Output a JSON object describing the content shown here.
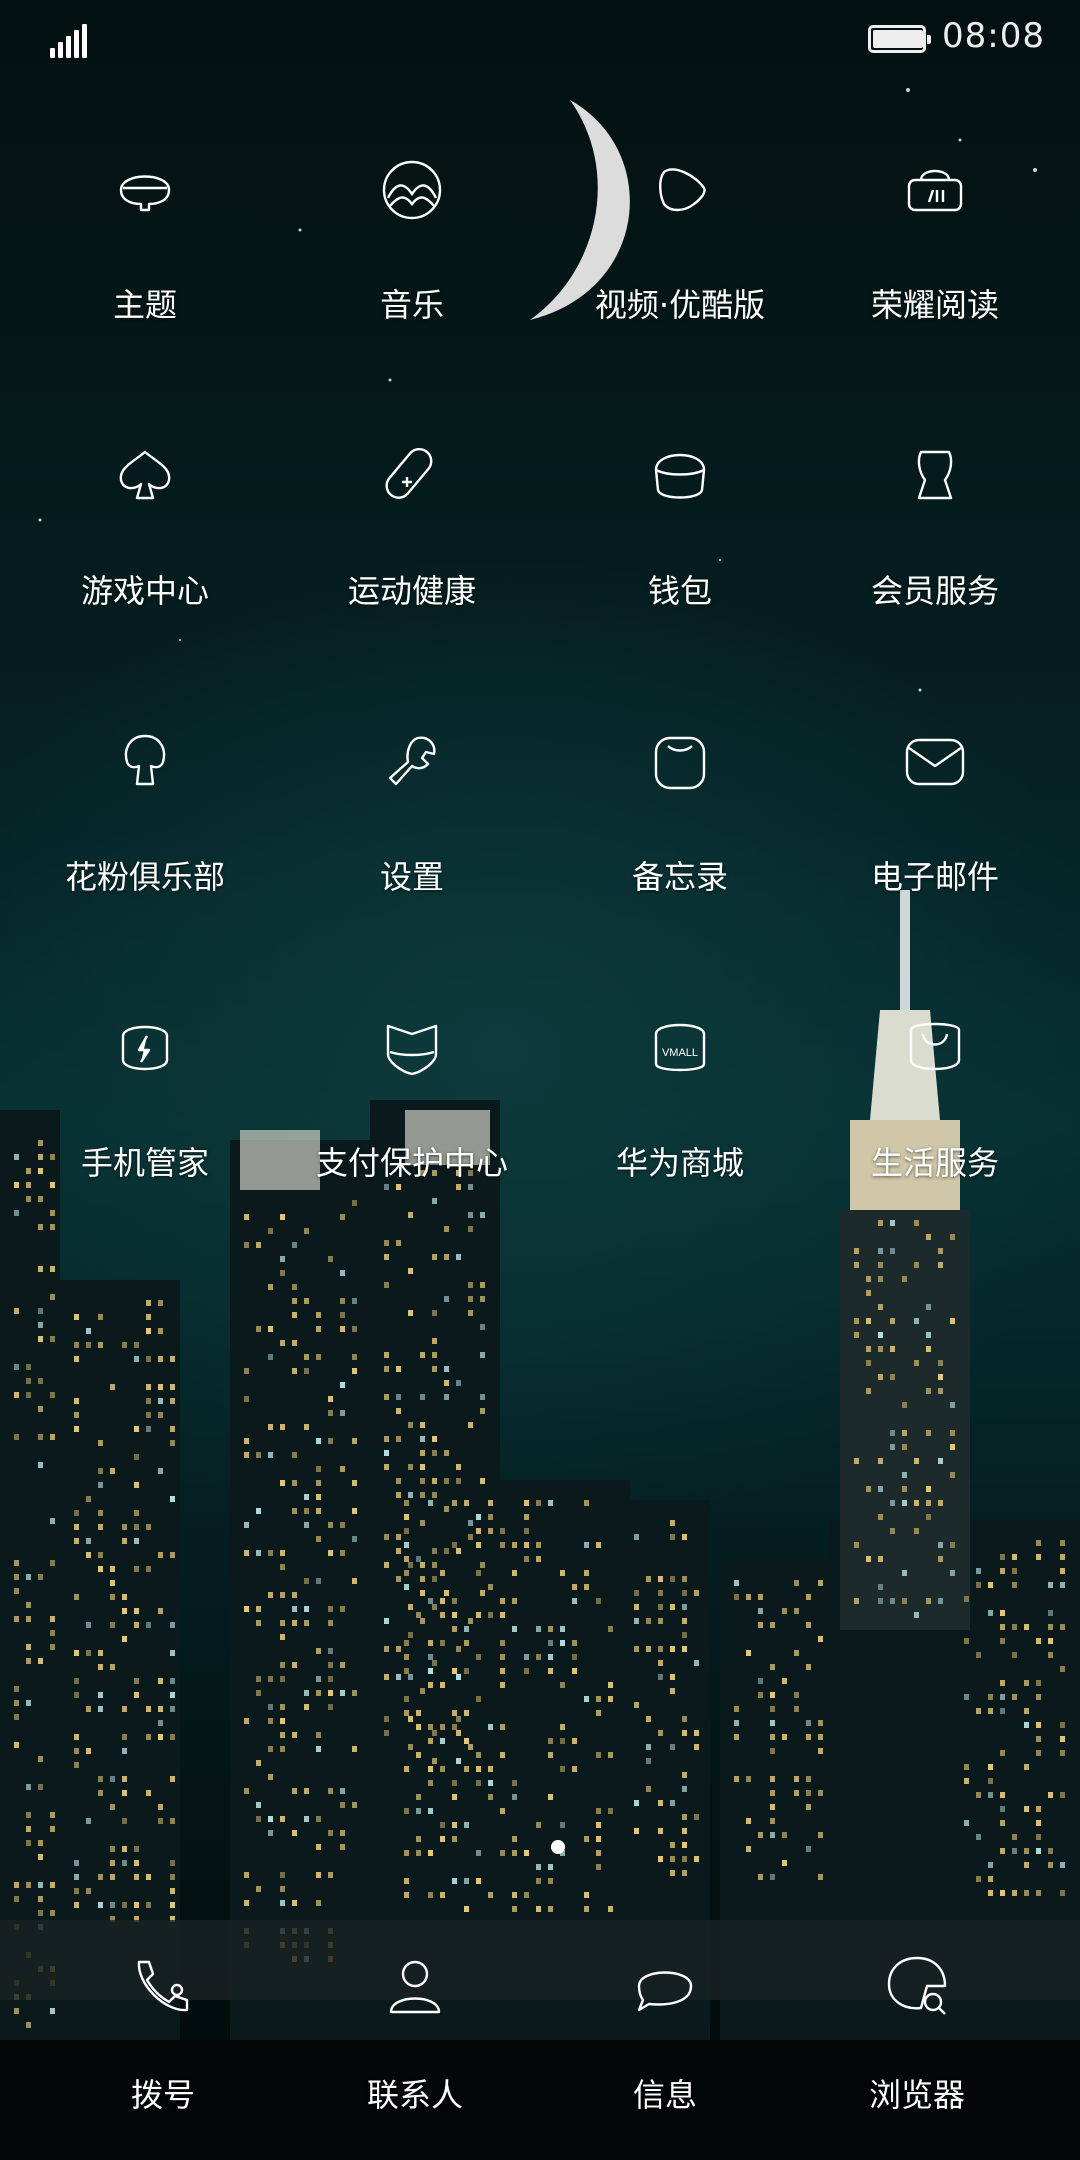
{
  "status_bar": {
    "time": "08:08",
    "signal_bars": 4,
    "battery_level": 1.0
  },
  "apps": [
    {
      "label": "主题",
      "icon": "theme-icon"
    },
    {
      "label": "音乐",
      "icon": "music-icon"
    },
    {
      "label": "视频·优酷版",
      "icon": "video-icon"
    },
    {
      "label": "荣耀阅读",
      "icon": "reader-icon"
    },
    {
      "label": "游戏中心",
      "icon": "game-center-icon"
    },
    {
      "label": "运动健康",
      "icon": "health-icon"
    },
    {
      "label": "钱包",
      "icon": "wallet-icon"
    },
    {
      "label": "会员服务",
      "icon": "member-icon"
    },
    {
      "label": "花粉俱乐部",
      "icon": "club-icon"
    },
    {
      "label": "设置",
      "icon": "settings-icon"
    },
    {
      "label": "备忘录",
      "icon": "notes-icon"
    },
    {
      "label": "电子邮件",
      "icon": "email-icon"
    },
    {
      "label": "手机管家",
      "icon": "phone-manager-icon"
    },
    {
      "label": "支付保护中心",
      "icon": "payment-protect-icon"
    },
    {
      "label": "华为商城",
      "icon": "vmall-icon",
      "icon_text": "VMALL"
    },
    {
      "label": "生活服务",
      "icon": "life-service-icon"
    }
  ],
  "dock": [
    {
      "label": "拨号",
      "icon": "dialer-icon"
    },
    {
      "label": "联系人",
      "icon": "contacts-icon"
    },
    {
      "label": "信息",
      "icon": "messages-icon"
    },
    {
      "label": "浏览器",
      "icon": "browser-icon"
    }
  ],
  "page_indicator": {
    "pages": 1,
    "current": 1
  },
  "colors": {
    "wallpaper_dark": "#041414",
    "wallpaper_teal": "#0d3a3c",
    "icon_stroke": "#ffffff",
    "city_light": "#f2d27a"
  }
}
